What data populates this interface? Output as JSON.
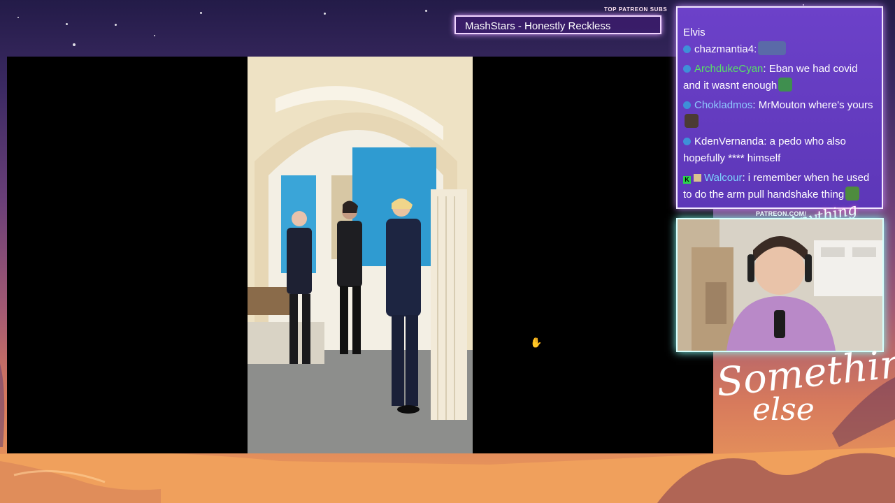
{
  "overlay": {
    "top_patreon_label": "TOP PATREON SUBS",
    "top_patreon_name": "MashStars - Honestly Reckless",
    "patreon_url_label": "PATREON.COM/",
    "cam_script": "Anything else",
    "logo_line1": "Something",
    "logo_line2": "else"
  },
  "chat": {
    "partial_top": "Elvis",
    "messages": [
      {
        "user": "chazmantia4",
        "sep": ":",
        "text": "",
        "user_color": "#ffffff",
        "badge": "circle",
        "emote": "#5a6aa8"
      },
      {
        "user": "ArchdukeCyan",
        "sep": ":",
        "text": " Eban we had covid and it wasnt enough",
        "user_color": "#58e066",
        "badge": "circle",
        "emote": "#3f8f4f"
      },
      {
        "user": "Chokladmos",
        "sep": ":",
        "text": " MrMouton where's yours",
        "user_color": "#8fc8ff",
        "badge": "circle",
        "emote": "#4b3b34"
      },
      {
        "user": "KdenVernanda",
        "sep": ":",
        "text": " a pedo who also hopefully **** himself",
        "user_color": "#ffffff",
        "badge": "circle",
        "emote": ""
      },
      {
        "user": "Walcour",
        "sep": ":",
        "text": " i remember when he used to do the arm pull handshake thing",
        "user_color": "#7dd4ff",
        "badge": "k",
        "emote": "#4e8c3e"
      }
    ]
  },
  "colors": {
    "chat_bg": "#6c41c9",
    "chat_border": "#f2e8ff",
    "cam_border": "#d5fffd",
    "player_bg": "#000000"
  }
}
